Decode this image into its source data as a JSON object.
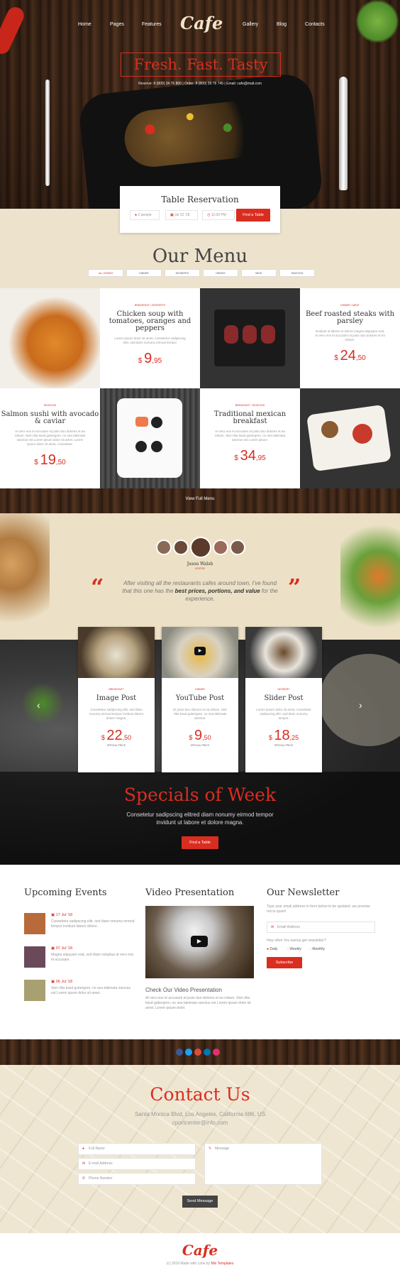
{
  "nav": {
    "home": "Home",
    "pages": "Pages",
    "features": "Features",
    "gallery": "Gallery",
    "blog": "Blog",
    "contacts": "Contacts"
  },
  "logo": "Cafe",
  "hero": {
    "tagline": "Fresh. Fast. Tasty",
    "contact_line": "Reserve: 8 (800) 34 76 800 | Order: 8 (800) 39 76 745 | Email: cafe@mail.com"
  },
  "reservation": {
    "title": "Table Reservation",
    "people": "2 people",
    "date": "Jul 22 '18",
    "time": "11:00 PM",
    "button": "Find a Table"
  },
  "menu": {
    "title": "Our Menu",
    "tabs": [
      "ALL DISHES",
      "DINNER",
      "DESSERTS",
      "DRINKS",
      "MEAT",
      "SEAFOOD"
    ],
    "items": [
      {
        "cat": "BREAKFAST / DESSERTS",
        "name": "Chicken soup with tomatoes, oranges and peppers",
        "desc": "Lorem ipsum dolor sit amet, consetetur sadipscing elitr, sed diam nonumy eirmod tempor",
        "currency": "$",
        "int": "9",
        "dec": ",95"
      },
      {
        "cat": "DINNER / MEAT",
        "name": "Beef roasted steaks with parsley",
        "desc": "Invidunt ut labore et dolore magna aliquyam erat, At vero eos et accusam et justo duo dolores et ea rebum.",
        "currency": "$",
        "int": "24",
        "dec": ",50"
      },
      {
        "cat": "SEAFOOD",
        "name": "Salmon sushi with avocado & caviar",
        "desc": "At vero eos et accusam et justo duo dolores et ea rebum. Stet clita kasd gubergren, no sea takimata sanctus est Lorem ipsum dolor sit amet. Lorem ipsum dolor sit amet, consetetur.",
        "currency": "$",
        "int": "19",
        "dec": ",50"
      },
      {
        "cat": "BREAKFAST / SEAFOOD",
        "name": "Traditional mexican breakfast",
        "desc": "At vero eos et accusam et justo duo dolores et ea rebum. Stet clita kasd gubergren, no sea takimata sanctus est Lorem ipsum.",
        "currency": "$",
        "int": "34",
        "dec": ",95"
      }
    ],
    "view_full": "View Full Menu"
  },
  "testimonial": {
    "name": "Jason Walsh",
    "role": "VISITOR",
    "quote_a": "After visiting all the restaurants cafes around town, I've found that this one has the ",
    "quote_bold": "best prices, portions, and value",
    "quote_b": " for the experience."
  },
  "posts": [
    {
      "cat": "BREAKFAST",
      "name": "Image Post",
      "desc": "Consetetur sadipscing elitr, sed diam nonumy eirmod tempor invidunt labore dolore magna.",
      "currency": "$",
      "int": "22",
      "dec": ",50",
      "special": "SPECIAL PRICE"
    },
    {
      "cat": "DINNER",
      "name": "YouTube Post",
      "desc": "Et justo duo dolores et ea rebum. Stet clita kasd gubergren, no sea takimata sanctus.",
      "currency": "$",
      "int": "9",
      "dec": ",50",
      "special": "SPECIAL PRICE"
    },
    {
      "cat": "DESSERT",
      "name": "Slider Post",
      "desc": "Lorem ipsum dolor sit amet, consetetur sadipscing elitr, sed diam nonumy tempor.",
      "currency": "$",
      "int": "18",
      "dec": ",25",
      "special": "SPECIAL PRICE"
    }
  ],
  "specials": {
    "title": "Specials of Week",
    "text": "Consetetur sadipscing elitred diam nonumy eirmod tempor invidunt ut labore et dolore magna.",
    "button": "Find a Table"
  },
  "events": {
    "title": "Upcoming Events",
    "items": [
      {
        "date": "17 Jul '18",
        "text": "Consetetur sadipscing elitr, sed diam nonumy eirmod tempor invidunt labore dolore."
      },
      {
        "date": "07 Jul '18",
        "text": "Magna aliquyam erat, sed diam voluptua at vero eos et accusam."
      },
      {
        "date": "06 Jul '18",
        "text": "Stet clita kasd gubergren, no sea takimata sanctus est Lorem ipsum dolor sit amet."
      }
    ]
  },
  "video": {
    "title": "Video Presentation",
    "subtitle": "Check Our Video Presentation",
    "text": "At vero eos et accusam et justo duo dolores et ea rebum. Stet clita kasd gubergren, no sea takimata sanctus est Lorem ipsum dolor sit amet. Lorem ipsum dolor."
  },
  "newsletter": {
    "title": "Our Newsletter",
    "text": "Type your email address in form below to be updated, we promise not to spam!",
    "email_placeholder": "Email Address",
    "question": "How often You wanna get newsletter?",
    "opt1": "Daily",
    "opt2": "Weekly",
    "opt3": "Monthly",
    "button": "Subscribe"
  },
  "contact": {
    "title": "Contact Us",
    "address": "Santa Monica Blvd, Los Angeles, California 686, US",
    "email": "cportcenter@info.com",
    "name_ph": "Full Name",
    "email_ph": "E-mail Address",
    "phone_ph": "Phone Number",
    "message_ph": "Message",
    "button": "Send Message"
  },
  "footer": {
    "logo": "Cafe",
    "copy": "(c) 2018 Made with Love by ",
    "brand": "Mix Templates"
  },
  "colors": {
    "accent": "#d92d20",
    "cream": "#ede3cc",
    "wood": "#3b2518"
  }
}
